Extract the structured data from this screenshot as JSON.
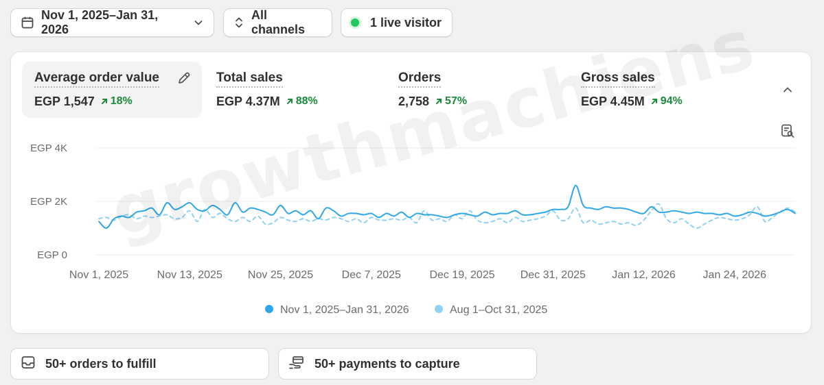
{
  "filters": {
    "date_range": "Nov 1, 2025–Jan 31, 2026",
    "channels": "All channels",
    "live_visitors": "1 live visitor"
  },
  "metrics": [
    {
      "label": "Average order value",
      "value": "EGP 1,547",
      "delta": "18%"
    },
    {
      "label": "Total sales",
      "value": "EGP 4.37M",
      "delta": "88%"
    },
    {
      "label": "Orders",
      "value": "2,758",
      "delta": "57%"
    },
    {
      "label": "Gross sales",
      "value": "EGP 4.45M",
      "delta": "94%"
    }
  ],
  "chart_data": {
    "type": "line",
    "title": "",
    "y_ticks": [
      "EGP 4K",
      "EGP 2K",
      "EGP 0"
    ],
    "ylim": [
      0,
      4000
    ],
    "x_ticks": [
      "Nov 1, 2025",
      "Nov 13, 2025",
      "Nov 25, 2025",
      "Dec 7, 2025",
      "Dec 19, 2025",
      "Dec 31, 2025",
      "Jan 12, 2026",
      "Jan 24, 2026"
    ],
    "x_tick_days": [
      0,
      12,
      24,
      36,
      48,
      60,
      72,
      84
    ],
    "grid": true,
    "legend_position": "bottom-center",
    "series": [
      {
        "name": "Nov 1, 2025–Jan 31, 2026",
        "color": "#2ea7e8",
        "style": "solid",
        "values": [
          1250,
          1000,
          1350,
          1450,
          1400,
          1600,
          1650,
          1750,
          1500,
          1950,
          1700,
          1800,
          1950,
          1700,
          1650,
          1850,
          1700,
          1500,
          1950,
          1600,
          1750,
          1700,
          1600,
          1500,
          1850,
          1550,
          1650,
          1500,
          1650,
          1350,
          1750,
          1650,
          1450,
          1550,
          1550,
          1500,
          1550,
          1400,
          1550,
          1450,
          1600,
          1400,
          1550,
          1500,
          1500,
          1450,
          1400,
          1500,
          1550,
          1500,
          1450,
          1600,
          1500,
          1550,
          1550,
          1650,
          1500,
          1500,
          1550,
          1600,
          1700,
          1700,
          1800,
          2600,
          1850,
          1750,
          1700,
          1800,
          1750,
          1750,
          1700,
          1600,
          1550,
          1800,
          1600,
          1600,
          1650,
          1600,
          1550,
          1600,
          1550,
          1550,
          1500,
          1550,
          1450,
          1500,
          1600,
          1550,
          1450,
          1500,
          1600,
          1700,
          1550
        ]
      },
      {
        "name": "Aug 1–Oct 31, 2025",
        "color": "#8fd0f5",
        "style": "dashed",
        "values": [
          1350,
          1400,
          1300,
          1450,
          1500,
          1350,
          1450,
          1400,
          1450,
          1500,
          1350,
          1400,
          1650,
          1250,
          1700,
          1400,
          1550,
          1350,
          1250,
          1400,
          1250,
          1450,
          1150,
          1200,
          1400,
          1300,
          1250,
          1350,
          1250,
          1350,
          1300,
          1400,
          1350,
          1250,
          1350,
          1200,
          1400,
          1300,
          1300,
          1350,
          1300,
          1400,
          1200,
          1650,
          1300,
          1350,
          1250,
          1500,
          1350,
          1650,
          1300,
          1200,
          1250,
          1350,
          1200,
          1400,
          1250,
          1300,
          1350,
          1450,
          1650,
          1300,
          1350,
          1750,
          1200,
          1300,
          1150,
          1200,
          1250,
          1150,
          1200,
          1100,
          1300,
          1650,
          1900,
          1350,
          1200,
          1350,
          1150,
          1000,
          1150,
          1300,
          1400,
          1350,
          1300,
          1350,
          1500,
          1800,
          1250,
          1400,
          1600,
          1750,
          1600
        ]
      }
    ]
  },
  "tasks": [
    {
      "label": "50+ orders to fulfill",
      "icon": "inbox-icon"
    },
    {
      "label": "50+ payments to capture",
      "icon": "hand-card-icon"
    }
  ],
  "watermark": "growthmachiens"
}
